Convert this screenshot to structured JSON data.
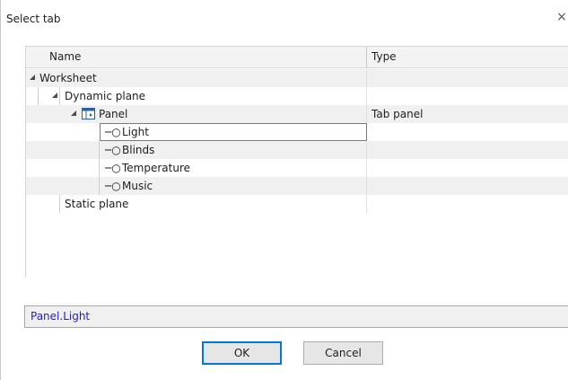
{
  "dialog": {
    "title": "Select tab",
    "close_glyph": "×"
  },
  "grid": {
    "columns": [
      "Name",
      "Type"
    ],
    "rows": [
      {
        "name": "Worksheet",
        "type": "",
        "level": 0,
        "expanded": true
      },
      {
        "name": "Dynamic plane",
        "type": "",
        "level": 1,
        "expanded": true
      },
      {
        "name": "Panel",
        "type": "Tab panel",
        "level": 2,
        "expanded": true,
        "icon": "tab-panel-icon"
      },
      {
        "name": "Light",
        "type": "",
        "level": 3,
        "selected": true,
        "icon": "pin-icon"
      },
      {
        "name": "Blinds",
        "type": "",
        "level": 3,
        "icon": "pin-icon"
      },
      {
        "name": "Temperature",
        "type": "",
        "level": 3,
        "icon": "pin-icon"
      },
      {
        "name": "Music",
        "type": "",
        "level": 3,
        "icon": "pin-icon"
      },
      {
        "name": "Static plane",
        "type": "",
        "level": 1
      }
    ]
  },
  "selection_path": "Panel.Light",
  "buttons": {
    "ok": "OK",
    "cancel": "Cancel"
  },
  "colors": {
    "path_text": "#1f1fd0",
    "ok_border": "#0078d7",
    "row_alt": "#f0f0f0"
  }
}
